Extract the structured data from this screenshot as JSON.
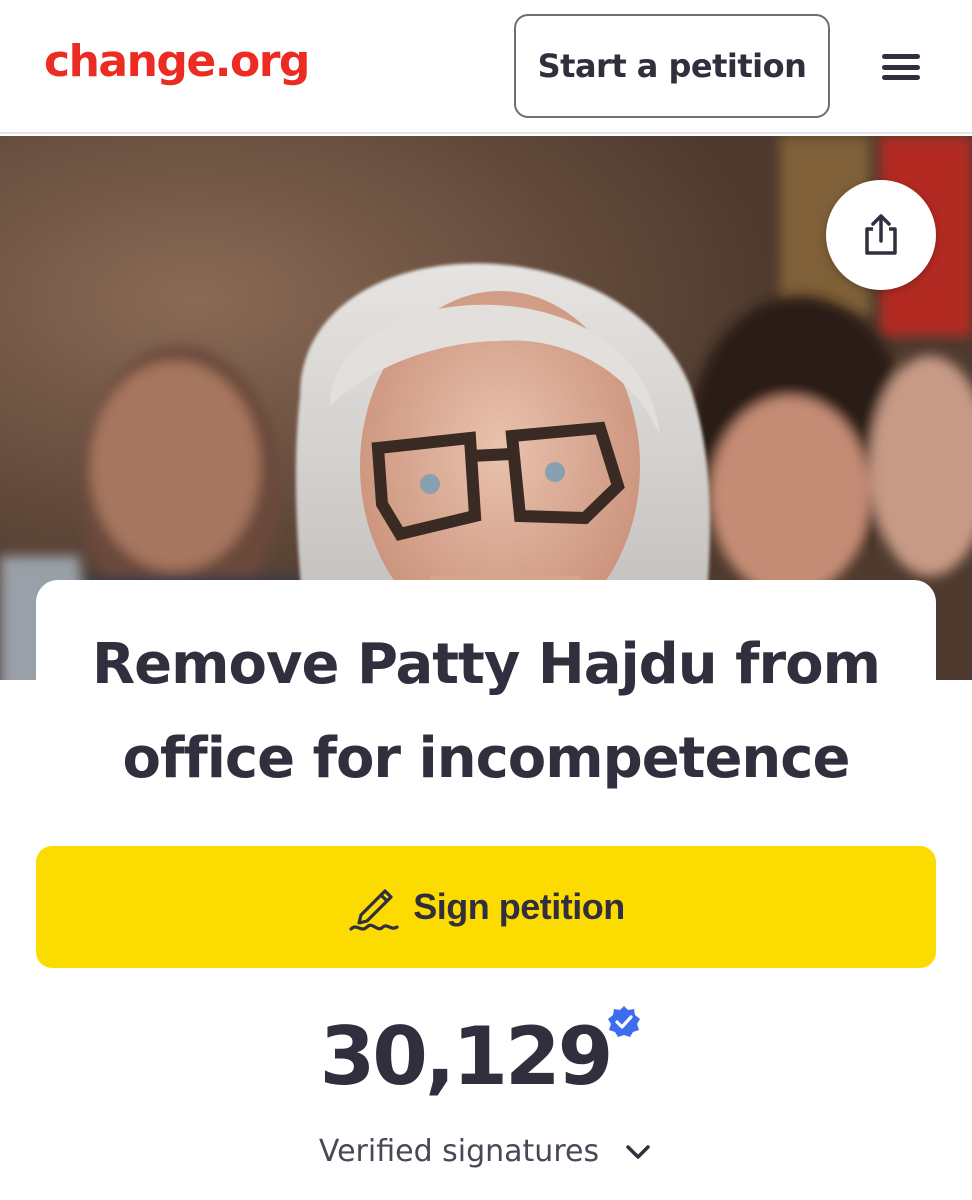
{
  "header": {
    "logo": "change.org",
    "start_petition_label": "Start a petition",
    "menu_icon": "hamburger-menu-icon"
  },
  "hero": {
    "share_icon": "share-icon"
  },
  "petition": {
    "title_line1": "Remove Patty Hajdu from",
    "title_line2": "office for incompetence",
    "sign_label": "Sign petition",
    "sign_icon": "pen-signature-icon",
    "signature_count": "30,129",
    "verified_icon": "verified-badge-icon",
    "signatures_label": "Verified signatures",
    "expand_icon": "chevron-down-icon"
  },
  "colors": {
    "brand_red": "#ec2c22",
    "sign_yellow": "#fcdc00",
    "text_dark": "#312f3d",
    "verified_blue": "#3e6cf0"
  }
}
